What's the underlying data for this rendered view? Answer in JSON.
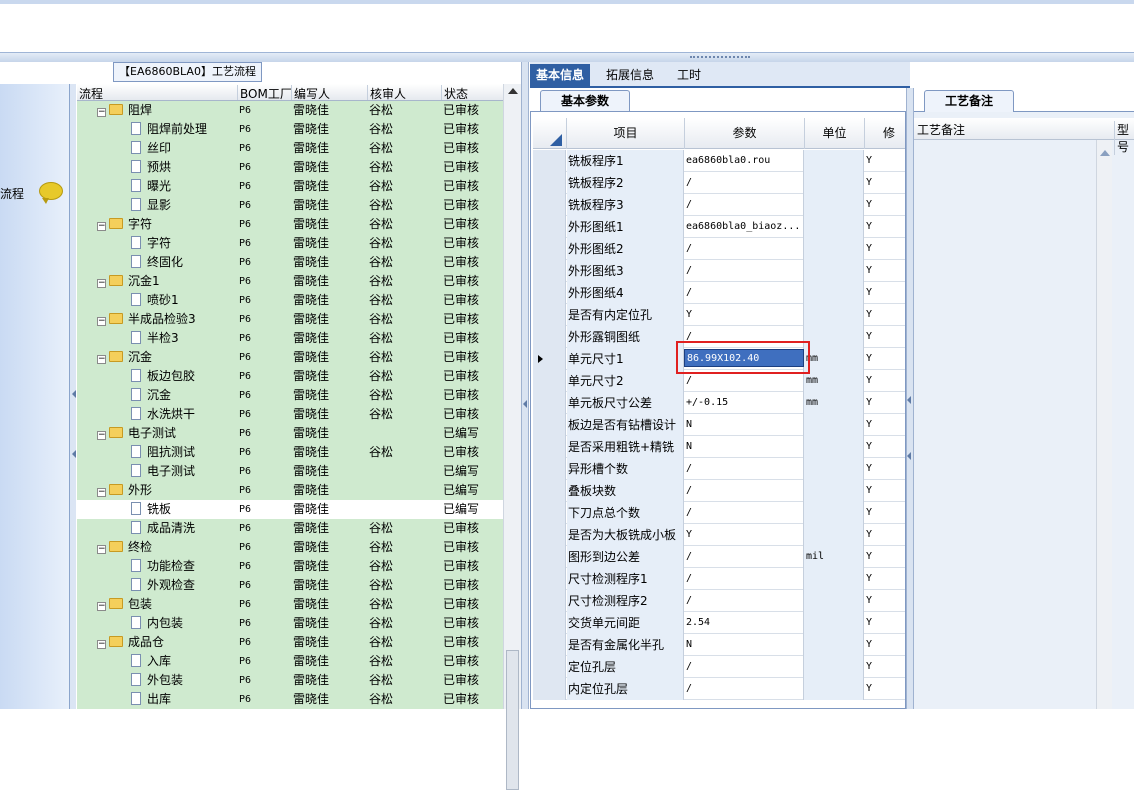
{
  "left_panel": {
    "label": "流程"
  },
  "tree_tab": {
    "title": "【EA6860BLA0】工艺流程"
  },
  "tree_columns": [
    "流程",
    "BOM工厂",
    "编写人",
    "核审人",
    "状态"
  ],
  "tree_rows": [
    {
      "level": 0,
      "type": "folder",
      "name": "阻焊",
      "plant": "P6",
      "writer": "雷晓佳",
      "reviewer": "谷松",
      "status": "已审核"
    },
    {
      "level": 1,
      "type": "doc",
      "name": "阻焊前处理",
      "plant": "P6",
      "writer": "雷晓佳",
      "reviewer": "谷松",
      "status": "已审核"
    },
    {
      "level": 1,
      "type": "doc",
      "name": "丝印",
      "plant": "P6",
      "writer": "雷晓佳",
      "reviewer": "谷松",
      "status": "已审核"
    },
    {
      "level": 1,
      "type": "doc",
      "name": "预烘",
      "plant": "P6",
      "writer": "雷晓佳",
      "reviewer": "谷松",
      "status": "已审核"
    },
    {
      "level": 1,
      "type": "doc",
      "name": "曝光",
      "plant": "P6",
      "writer": "雷晓佳",
      "reviewer": "谷松",
      "status": "已审核"
    },
    {
      "level": 1,
      "type": "doc",
      "name": "显影",
      "plant": "P6",
      "writer": "雷晓佳",
      "reviewer": "谷松",
      "status": "已审核"
    },
    {
      "level": 0,
      "type": "folder",
      "name": "字符",
      "plant": "P6",
      "writer": "雷晓佳",
      "reviewer": "谷松",
      "status": "已审核"
    },
    {
      "level": 1,
      "type": "doc",
      "name": "字符",
      "plant": "P6",
      "writer": "雷晓佳",
      "reviewer": "谷松",
      "status": "已审核"
    },
    {
      "level": 1,
      "type": "doc",
      "name": "终固化",
      "plant": "P6",
      "writer": "雷晓佳",
      "reviewer": "谷松",
      "status": "已审核"
    },
    {
      "level": 0,
      "type": "folder",
      "name": "沉金1",
      "plant": "P6",
      "writer": "雷晓佳",
      "reviewer": "谷松",
      "status": "已审核"
    },
    {
      "level": 1,
      "type": "doc",
      "name": "喷砂1",
      "plant": "P6",
      "writer": "雷晓佳",
      "reviewer": "谷松",
      "status": "已审核"
    },
    {
      "level": 0,
      "type": "folder",
      "name": "半成品检验3",
      "plant": "P6",
      "writer": "雷晓佳",
      "reviewer": "谷松",
      "status": "已审核"
    },
    {
      "level": 1,
      "type": "doc",
      "name": "半检3",
      "plant": "P6",
      "writer": "雷晓佳",
      "reviewer": "谷松",
      "status": "已审核"
    },
    {
      "level": 0,
      "type": "folder",
      "name": "沉金",
      "plant": "P6",
      "writer": "雷晓佳",
      "reviewer": "谷松",
      "status": "已审核"
    },
    {
      "level": 1,
      "type": "doc",
      "name": "板边包胶",
      "plant": "P6",
      "writer": "雷晓佳",
      "reviewer": "谷松",
      "status": "已审核"
    },
    {
      "level": 1,
      "type": "doc",
      "name": "沉金",
      "plant": "P6",
      "writer": "雷晓佳",
      "reviewer": "谷松",
      "status": "已审核"
    },
    {
      "level": 1,
      "type": "doc",
      "name": "水洗烘干",
      "plant": "P6",
      "writer": "雷晓佳",
      "reviewer": "谷松",
      "status": "已审核"
    },
    {
      "level": 0,
      "type": "folder",
      "name": "电子测试",
      "plant": "P6",
      "writer": "雷晓佳",
      "reviewer": "",
      "status": "已编写"
    },
    {
      "level": 1,
      "type": "doc",
      "name": "阻抗测试",
      "plant": "P6",
      "writer": "雷晓佳",
      "reviewer": "谷松",
      "status": "已审核"
    },
    {
      "level": 1,
      "type": "doc",
      "name": "电子测试",
      "plant": "P6",
      "writer": "雷晓佳",
      "reviewer": "",
      "status": "已编写"
    },
    {
      "level": 0,
      "type": "folder",
      "name": "外形",
      "plant": "P6",
      "writer": "雷晓佳",
      "reviewer": "",
      "status": "已编写"
    },
    {
      "level": 1,
      "type": "doc",
      "name": "铣板",
      "plant": "P6",
      "writer": "雷晓佳",
      "reviewer": "",
      "status": "已编写",
      "selected": true
    },
    {
      "level": 1,
      "type": "doc",
      "name": "成品清洗",
      "plant": "P6",
      "writer": "雷晓佳",
      "reviewer": "谷松",
      "status": "已审核"
    },
    {
      "level": 0,
      "type": "folder",
      "name": "终检",
      "plant": "P6",
      "writer": "雷晓佳",
      "reviewer": "谷松",
      "status": "已审核"
    },
    {
      "level": 1,
      "type": "doc",
      "name": "功能检查",
      "plant": "P6",
      "writer": "雷晓佳",
      "reviewer": "谷松",
      "status": "已审核"
    },
    {
      "level": 1,
      "type": "doc",
      "name": "外观检查",
      "plant": "P6",
      "writer": "雷晓佳",
      "reviewer": "谷松",
      "status": "已审核"
    },
    {
      "level": 0,
      "type": "folder",
      "name": "包装",
      "plant": "P6",
      "writer": "雷晓佳",
      "reviewer": "谷松",
      "status": "已审核"
    },
    {
      "level": 1,
      "type": "doc",
      "name": "内包装",
      "plant": "P6",
      "writer": "雷晓佳",
      "reviewer": "谷松",
      "status": "已审核"
    },
    {
      "level": 0,
      "type": "folder",
      "name": "成品仓",
      "plant": "P6",
      "writer": "雷晓佳",
      "reviewer": "谷松",
      "status": "已审核"
    },
    {
      "level": 1,
      "type": "doc",
      "name": "入库",
      "plant": "P6",
      "writer": "雷晓佳",
      "reviewer": "谷松",
      "status": "已审核"
    },
    {
      "level": 1,
      "type": "doc",
      "name": "外包装",
      "plant": "P6",
      "writer": "雷晓佳",
      "reviewer": "谷松",
      "status": "已审核"
    },
    {
      "level": 1,
      "type": "doc",
      "name": "出库",
      "plant": "P6",
      "writer": "雷晓佳",
      "reviewer": "谷松",
      "status": "已审核"
    }
  ],
  "right_tabs": [
    "基本信息",
    "拓展信息",
    "工时"
  ],
  "active_right_tab": "基本信息",
  "sub_tab": "基本参数",
  "grid_columns": [
    "项目",
    "参数",
    "单位",
    "修改"
  ],
  "grid_rows": [
    {
      "item": "铣板程序1",
      "param": "ea6860bla0.rou",
      "unit": "",
      "mod": "Y"
    },
    {
      "item": "铣板程序2",
      "param": "/",
      "unit": "",
      "mod": "Y"
    },
    {
      "item": "铣板程序3",
      "param": "/",
      "unit": "",
      "mod": "Y"
    },
    {
      "item": "外形图纸1",
      "param": "ea6860bla0_biaoz...",
      "unit": "",
      "mod": "Y"
    },
    {
      "item": "外形图纸2",
      "param": "/",
      "unit": "",
      "mod": "Y"
    },
    {
      "item": "外形图纸3",
      "param": "/",
      "unit": "",
      "mod": "Y"
    },
    {
      "item": "外形图纸4",
      "param": "/",
      "unit": "",
      "mod": "Y"
    },
    {
      "item": "是否有内定位孔",
      "param": "Y",
      "unit": "",
      "mod": "Y"
    },
    {
      "item": "外形露铜图纸",
      "param": "/",
      "unit": "",
      "mod": "Y"
    },
    {
      "item": "单元尺寸1",
      "param": "86.99X102.40",
      "unit": "mm",
      "mod": "Y",
      "current": true
    },
    {
      "item": "单元尺寸2",
      "param": "/",
      "unit": "mm",
      "mod": "Y"
    },
    {
      "item": "单元板尺寸公差",
      "param": "+/-0.15",
      "unit": "mm",
      "mod": "Y"
    },
    {
      "item": "板边是否有钻槽设计",
      "param": "N",
      "unit": "",
      "mod": "Y"
    },
    {
      "item": "是否采用粗铣+精铣",
      "param": "N",
      "unit": "",
      "mod": "Y"
    },
    {
      "item": "异形槽个数",
      "param": "/",
      "unit": "",
      "mod": "Y"
    },
    {
      "item": "叠板块数",
      "param": "/",
      "unit": "",
      "mod": "Y"
    },
    {
      "item": "下刀点总个数",
      "param": "/",
      "unit": "",
      "mod": "Y"
    },
    {
      "item": "是否为大板铣成小板",
      "param": "Y",
      "unit": "",
      "mod": "Y"
    },
    {
      "item": "图形到边公差",
      "param": "/",
      "unit": "mil",
      "mod": "Y"
    },
    {
      "item": "尺寸检测程序1",
      "param": "/",
      "unit": "",
      "mod": "Y"
    },
    {
      "item": "尺寸检测程序2",
      "param": "/",
      "unit": "",
      "mod": "Y"
    },
    {
      "item": "交货单元间距",
      "param": "2.54",
      "unit": "",
      "mod": "Y"
    },
    {
      "item": "是否有金属化半孔",
      "param": "N",
      "unit": "",
      "mod": "Y"
    },
    {
      "item": "定位孔层",
      "param": "/",
      "unit": "",
      "mod": "Y"
    },
    {
      "item": "内定位孔层",
      "param": "/",
      "unit": "",
      "mod": "Y"
    }
  ],
  "editing_value": "86.99X102.40",
  "remarks": {
    "tab": "工艺备注",
    "col1": "工艺备注",
    "col2": "型号"
  },
  "colors": {
    "tree_bg": "#cfeacf",
    "tab_active": "#2f5fa3",
    "highlight": "#e02020",
    "selection": "#3f6fbf"
  }
}
